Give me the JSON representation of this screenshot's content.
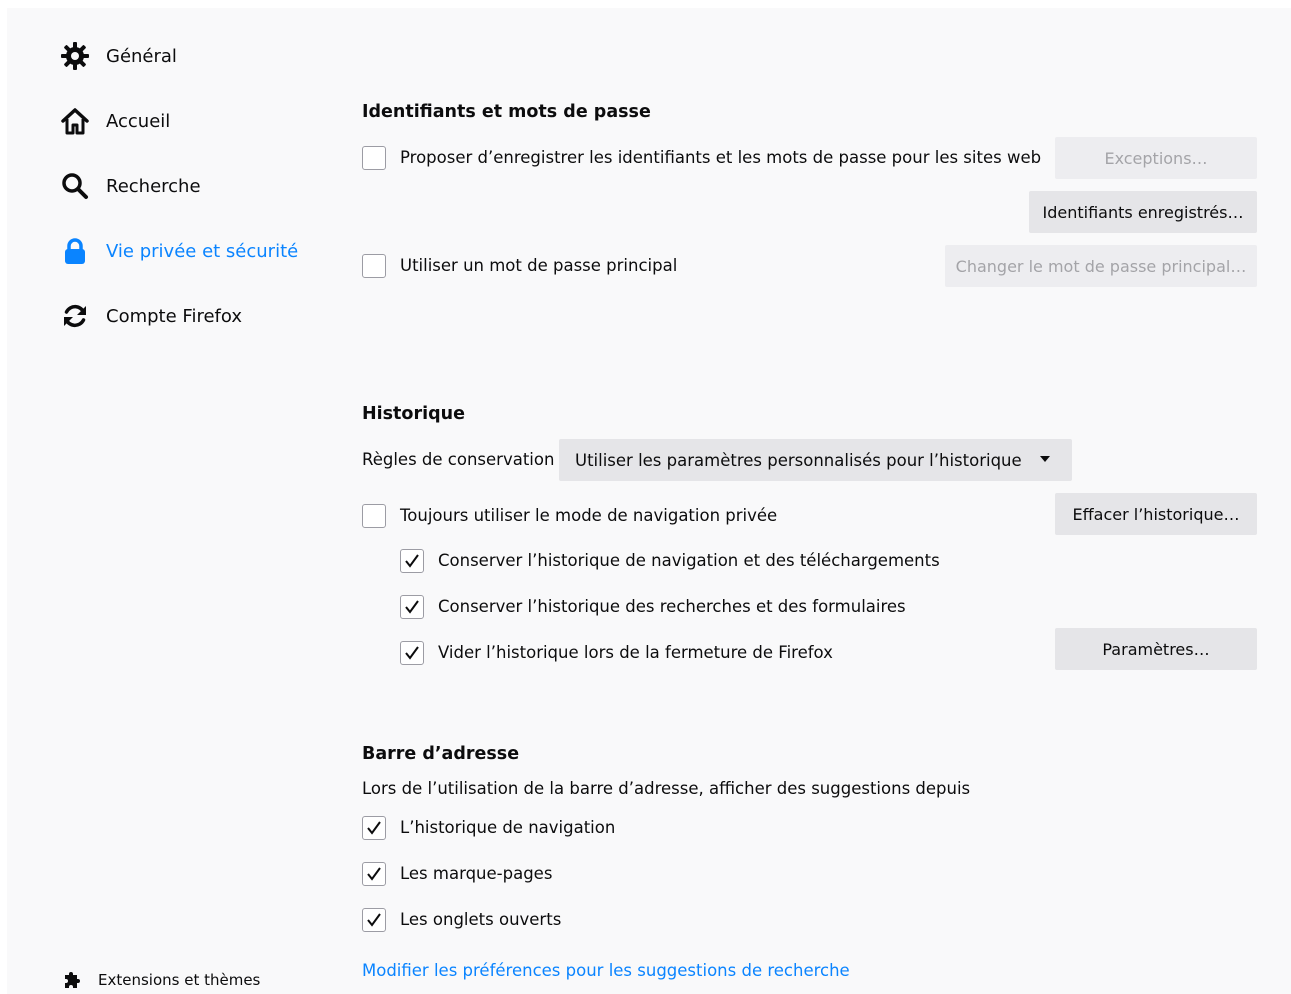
{
  "sidebar": {
    "items": [
      {
        "label": "Général",
        "icon": "gear-icon"
      },
      {
        "label": "Accueil",
        "icon": "home-icon"
      },
      {
        "label": "Recherche",
        "icon": "search-icon"
      },
      {
        "label": "Vie privée et sécurité",
        "icon": "lock-icon",
        "selected": true
      },
      {
        "label": "Compte Firefox",
        "icon": "sync-icon"
      }
    ],
    "extensions": {
      "label": "Extensions et thèmes",
      "icon": "puzzle-icon"
    }
  },
  "colors": {
    "accent": "#0a84ff",
    "background": "#f9f9fa",
    "button": "#e5e5e8"
  },
  "logins": {
    "heading": "Identifiants et mots de passe",
    "offer_save": {
      "label": "Proposer d’enregistrer les identifiants et les mots de passe pour les sites web",
      "checked": false
    },
    "exceptions_button": "Exceptions…",
    "saved_logins_button": "Identifiants enregistrés…",
    "master_password": {
      "label": "Utiliser un mot de passe principal",
      "checked": false
    },
    "change_master_button": "Changer le mot de passe principal…"
  },
  "history": {
    "heading": "Historique",
    "rules_label": "Règles de conservation",
    "rules_value": "Utiliser les paramètres personnalisés pour l’historique",
    "always_private": {
      "label": "Toujours utiliser le mode de navigation privée",
      "checked": false
    },
    "clear_button": "Effacer l’historique…",
    "keep_browsing": {
      "label": "Conserver l’historique de navigation et des téléchargements",
      "checked": true
    },
    "keep_search": {
      "label": "Conserver l’historique des recherches et des formulaires",
      "checked": true
    },
    "clear_on_close": {
      "label": "Vider l’historique lors de la fermeture de Firefox",
      "checked": true
    },
    "settings_button": "Paramètres…"
  },
  "addressbar": {
    "heading": "Barre d’adresse",
    "description": "Lors de l’utilisation de la barre d’adresse, afficher des suggestions depuis",
    "history": {
      "label": "L’historique de navigation",
      "checked": true
    },
    "bookmarks": {
      "label": "Les marque-pages",
      "checked": true
    },
    "open_tabs": {
      "label": "Les onglets ouverts",
      "checked": true
    },
    "search_prefs_link": "Modifier les préférences pour les suggestions de recherche"
  }
}
